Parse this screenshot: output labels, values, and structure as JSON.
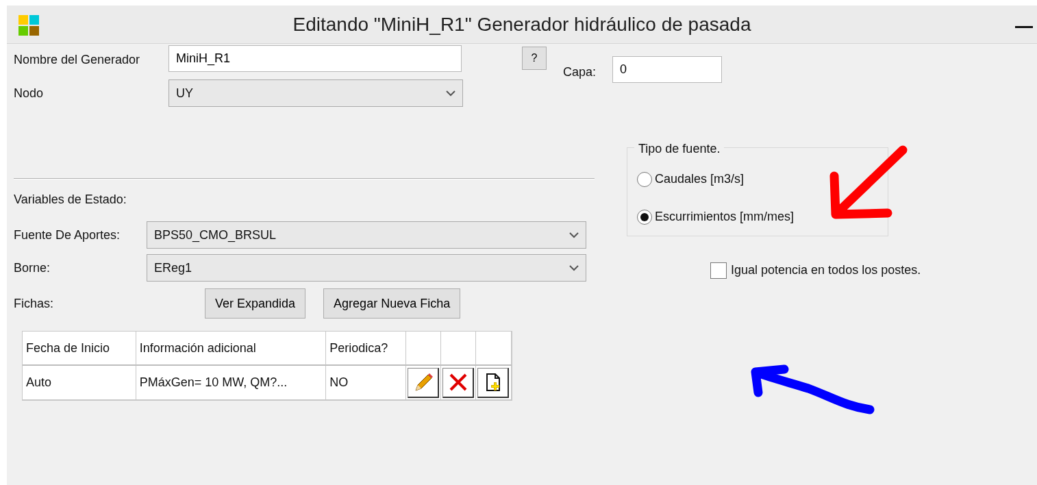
{
  "window": {
    "title": "Editando \"MiniH_R1\" Generador hidráulico de pasada"
  },
  "nombre": {
    "label": "Nombre del Generador",
    "value": "MiniH_R1"
  },
  "help_button": "?",
  "capa": {
    "label": "Capa:",
    "value": "0"
  },
  "nodo": {
    "label": "Nodo",
    "value": "UY"
  },
  "state_vars_title": "Variables de Estado:",
  "fuente": {
    "label": "Fuente De Aportes:",
    "value": "BPS50_CMO_BRSUL"
  },
  "borne": {
    "label": "Borne:",
    "value": "EReg1"
  },
  "fichas": {
    "label": "Fichas:",
    "buttons": [
      "Ver Expandida",
      "Agregar Nueva Ficha"
    ]
  },
  "table": {
    "columns": [
      "Fecha de Inicio",
      "Información adicional",
      "Periodica?"
    ],
    "rows": [
      {
        "cells": [
          "Auto",
          "PMáxGen= 10 MW, QM?...",
          "NO"
        ],
        "actions": [
          {
            "kind": "edit"
          },
          {
            "kind": "delete"
          },
          {
            "kind": "copy"
          }
        ]
      }
    ]
  },
  "source_type": {
    "title": "Tipo de fuente.",
    "options": [
      {
        "label": "Caudales [m3/s]",
        "selected": false
      },
      {
        "label": "Escurrimientos [mm/mes]",
        "selected": true
      }
    ]
  },
  "equal_power": {
    "label": "Igual potencia en todos los postes.",
    "checked": false
  },
  "annotations": [
    {
      "kind": "arrow",
      "color": "#ff0000"
    },
    {
      "kind": "arrow",
      "color": "#0000ff"
    }
  ]
}
